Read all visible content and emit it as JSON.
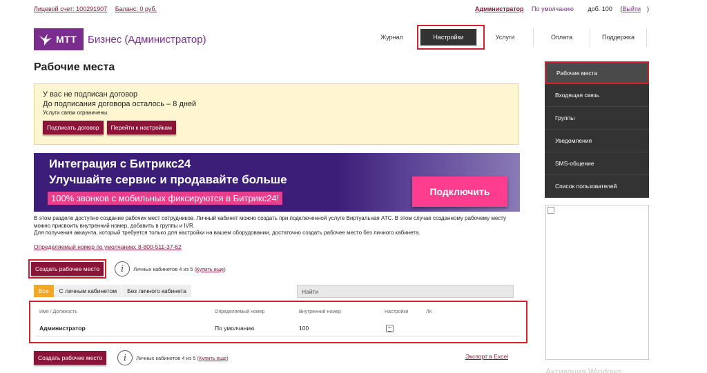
{
  "topbar": {
    "account_label": "Лицевой счет: 100291907",
    "balance_label": "Баланс: 0 руб.",
    "user": "Администратор",
    "default_label": "По умолчанию",
    "ext_label": "доб. 100",
    "exit_open": "(",
    "exit_label": "Выйти",
    "exit_close": ")"
  },
  "logo": {
    "mark": "МТТ",
    "brand": "Бизнес (Администратор)"
  },
  "nav": {
    "items": [
      "Журнал",
      "Настройки",
      "Услуги",
      "Оплата",
      "Поддержка"
    ],
    "active": "Настройки"
  },
  "page": {
    "title": "Рабочие места"
  },
  "notice": {
    "line1": "У вас не подписан договор",
    "line2": "До подписания договора осталось – 8 дней",
    "line3": "Услуги связи ограничены",
    "sign_button": "Подписать договор",
    "settings_button": "Перейти к настройкам"
  },
  "banner": {
    "title1": "Интеграция с Битрикс24",
    "title2": "Улучшайте сервис и продавайте больше",
    "tag": "100% звонков с мобильных фиксируются в Битрикс24!",
    "cta": "Подключить"
  },
  "description": {
    "p1": "В этом разделе доступно создание рабочих мест сотрудников. Личный кабинет можно создать при подключенной услуге Виртуальная АТС. В этом случае созданному рабочему месту можно присвоить внутренний номер, добавить в группы и IVR.",
    "p2": "Для получения аккаунта, который требуется только для настройки на вашем оборудовании, достаточно создать рабочее место без личного кабинета."
  },
  "default_number": "Определяемый номер по умолчанию: 8-800-511-37-62",
  "create_button": "Создать рабочее место",
  "cabinets_text": "Личных кабинетов 4 из 5",
  "buy_more": "Купить еще",
  "tabs": [
    "Все",
    "С личным кабинетом",
    "Без личного кабинета"
  ],
  "search": {
    "placeholder": "Найти"
  },
  "table": {
    "headers": [
      "Имя / Должность",
      "Определяемый номер",
      "Внутренний номер",
      "Настройки",
      "ЛК"
    ],
    "rows": [
      {
        "name": "Администратор",
        "number": "По умолчанию",
        "internal": "100",
        "lk": ""
      }
    ]
  },
  "export_label": "Экспорт в Excel",
  "sidemenu": {
    "items": [
      "Рабочие места",
      "Входящая связь",
      "Группы",
      "Уведомления",
      "SMS-общение",
      "Список пользователей"
    ],
    "selected": "Рабочие места"
  },
  "watermark": "Активация Windows",
  "colors": {
    "brand": "#7b2d8e",
    "button": "#8a1538",
    "highlight": "#d42030",
    "tab_active": "#f5a623",
    "banner_bg": "#3c1e78",
    "cta": "#ff3d8f"
  }
}
